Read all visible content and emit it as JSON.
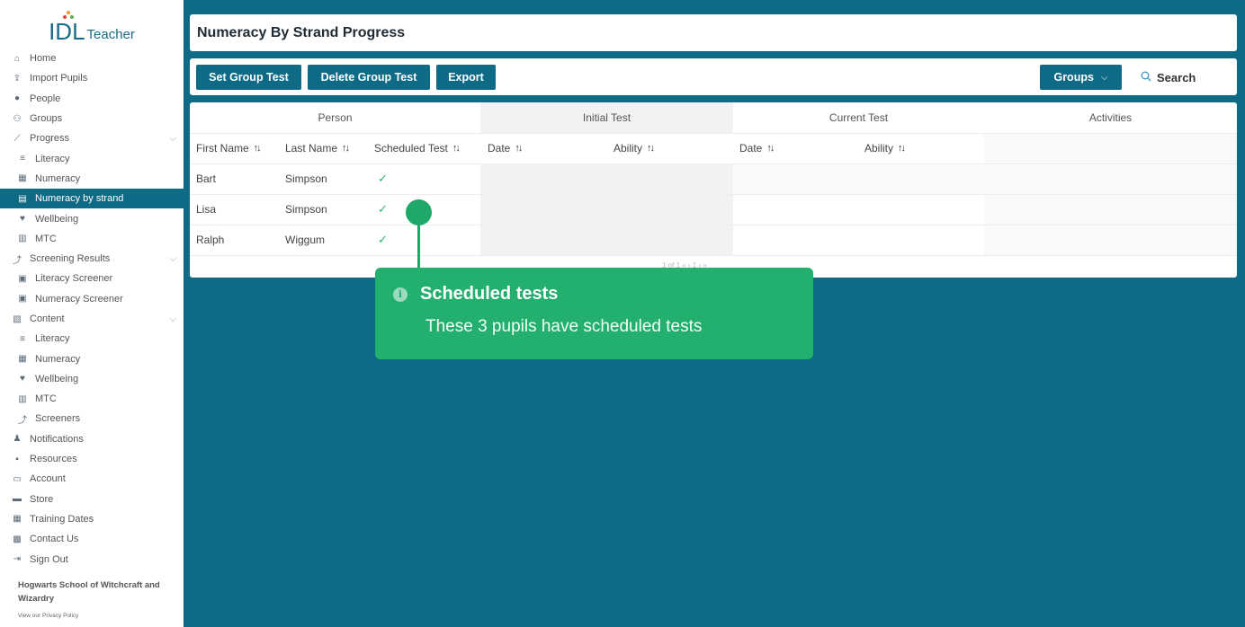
{
  "brand": {
    "logo_main": "IDL",
    "logo_sub": "Teacher"
  },
  "sidebar": {
    "items": [
      {
        "label": "Home",
        "icon": "home-icon"
      },
      {
        "label": "Import Pupils",
        "icon": "import-icon"
      },
      {
        "label": "People",
        "icon": "person-icon"
      },
      {
        "label": "Groups",
        "icon": "groups-icon"
      },
      {
        "label": "Progress",
        "icon": "chart-icon"
      },
      {
        "label": "Literacy",
        "icon": "book-icon"
      },
      {
        "label": "Numeracy",
        "icon": "numeracy-icon"
      },
      {
        "label": "Numeracy by strand",
        "icon": "calculator-icon"
      },
      {
        "label": "Wellbeing",
        "icon": "wellbeing-icon"
      },
      {
        "label": "MTC",
        "icon": "mtc-icon"
      },
      {
        "label": "Screening Results",
        "icon": "screening-icon"
      },
      {
        "label": "Literacy Screener",
        "icon": "literacy-screener-icon"
      },
      {
        "label": "Numeracy Screener",
        "icon": "numeracy-screener-icon"
      },
      {
        "label": "Content",
        "icon": "content-icon"
      },
      {
        "label": "Literacy",
        "icon": "book-icon"
      },
      {
        "label": "Numeracy",
        "icon": "numeracy-icon"
      },
      {
        "label": "Wellbeing",
        "icon": "wellbeing-icon"
      },
      {
        "label": "MTC",
        "icon": "mtc-icon"
      },
      {
        "label": "Screeners",
        "icon": "screening-icon"
      },
      {
        "label": "Notifications",
        "icon": "bell-icon"
      },
      {
        "label": "Resources",
        "icon": "resources-icon"
      },
      {
        "label": "Account",
        "icon": "account-icon"
      },
      {
        "label": "Store",
        "icon": "store-icon"
      },
      {
        "label": "Training Dates",
        "icon": "calendar-icon"
      },
      {
        "label": "Contact Us",
        "icon": "contact-icon"
      },
      {
        "label": "Sign Out",
        "icon": "sign-out-icon"
      }
    ],
    "school": "Hogwarts School of Witchcraft and Wizardry",
    "privacy": "View our Privacy Policy"
  },
  "page": {
    "title": "Numeracy By Strand Progress"
  },
  "toolbar": {
    "set_group_test": "Set Group Test",
    "delete_group_test": "Delete Group Test",
    "export": "Export",
    "groups": "Groups",
    "search": "Search"
  },
  "table": {
    "groups": [
      "Person",
      "Initial Test",
      "Current Test",
      "Activities"
    ],
    "columns": [
      "First Name",
      "Last Name",
      "Scheduled Test",
      "Date",
      "Ability",
      "Date",
      "Ability"
    ],
    "rows": [
      {
        "first": "Bart",
        "last": "Simpson",
        "scheduled": "✓"
      },
      {
        "first": "Lisa",
        "last": "Simpson",
        "scheduled": "✓"
      },
      {
        "first": "Ralph",
        "last": "Wiggum",
        "scheduled": "✓"
      }
    ],
    "pager": "1 of 1   «   ‹   1   ›   »"
  },
  "tooltip": {
    "title": "Scheduled tests",
    "body": "These 3 pupils have scheduled tests"
  },
  "colors": {
    "primary": "#0f6a86",
    "tooltip": "#23b06e",
    "check": "#2fb36a"
  }
}
